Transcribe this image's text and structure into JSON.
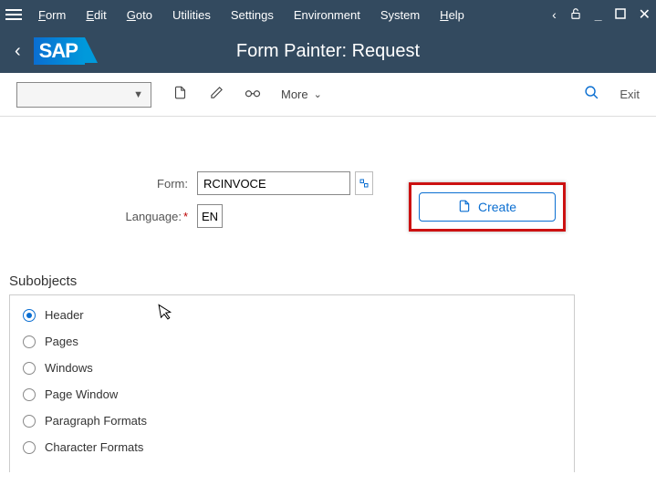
{
  "menu": {
    "items": [
      "Form",
      "Edit",
      "Goto",
      "Utilities",
      "Settings",
      "Environment",
      "System",
      "Help"
    ]
  },
  "header": {
    "logo": "SAP",
    "title": "Form Painter: Request"
  },
  "toolbar": {
    "more_label": "More",
    "exit_label": "Exit"
  },
  "fields": {
    "form_label": "Form:",
    "form_value": "RCINVOCE",
    "lang_label": "Language:",
    "lang_value": "EN"
  },
  "actions": {
    "create_label": "Create"
  },
  "subobjects": {
    "title": "Subobjects",
    "options": [
      {
        "label": "Header",
        "checked": true
      },
      {
        "label": "Pages",
        "checked": false
      },
      {
        "label": "Windows",
        "checked": false
      },
      {
        "label": "Page Window",
        "checked": false
      },
      {
        "label": "Paragraph Formats",
        "checked": false
      },
      {
        "label": "Character Formats",
        "checked": false
      }
    ]
  }
}
